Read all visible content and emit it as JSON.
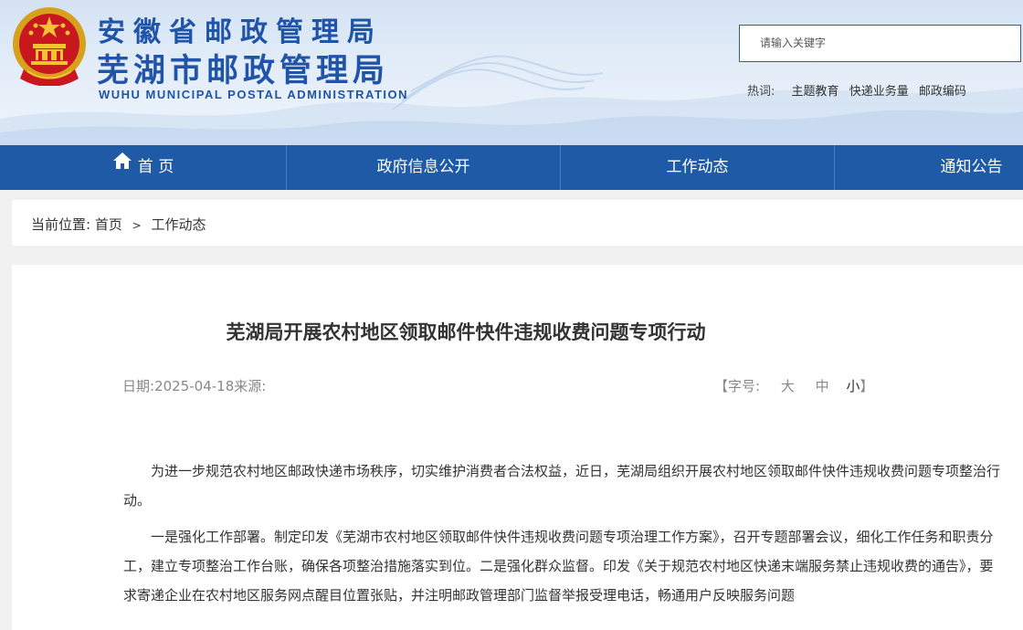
{
  "header": {
    "title_cn_province": "安徽省邮政管理局",
    "title_cn_city": "芜湖市邮政管理局",
    "title_en": "WUHU MUNICIPAL POSTAL ADMINISTRATION",
    "emblem_icon": "national-emblem-icon",
    "brand_color": "#1f54a8"
  },
  "search": {
    "placeholder": "请输入关键字"
  },
  "hotwords": {
    "label": "热词:",
    "items": [
      "主题教育",
      "快递业务量",
      "邮政编码"
    ]
  },
  "nav": {
    "home_icon": "home-icon",
    "items": [
      "首 页",
      "政府信息公开",
      "工作动态",
      "通知公告"
    ],
    "bg_color": "#1f5aa7"
  },
  "breadcrumb": {
    "prefix": "当前位置:",
    "home": "首页",
    "separator": ">",
    "current": "工作动态"
  },
  "article": {
    "title": "芜湖局开展农村地区领取邮件快件违规收费问题专项行动",
    "date_label": "日期:",
    "date": "2025-04-18",
    "source_label": "来源:",
    "fontsize": {
      "open": "【字号:",
      "large": "大",
      "medium": "中",
      "small": "小",
      "close": "】"
    },
    "paragraphs": [
      "为进一步规范农村地区邮政快递市场秩序，切实维护消费者合法权益，近日，芜湖局组织开展农村地区领取邮件快件违规收费问题专项整治行动。",
      "一是强化工作部署。制定印发《芜湖市农村地区领取邮件快件违规收费问题专项治理工作方案》，召开专题部署会议，细化工作任务和职责分工，建立专项整治工作台账，确保各项整治措施落实到位。二是强化群众监督。印发《关于规范农村地区快递末端服务禁止违规收费的通告》，要求寄递企业在农村地区服务网点醒目位置张贴，并注明邮政管理部门监督举报受理电话，畅通用户反映服务问题"
    ]
  }
}
